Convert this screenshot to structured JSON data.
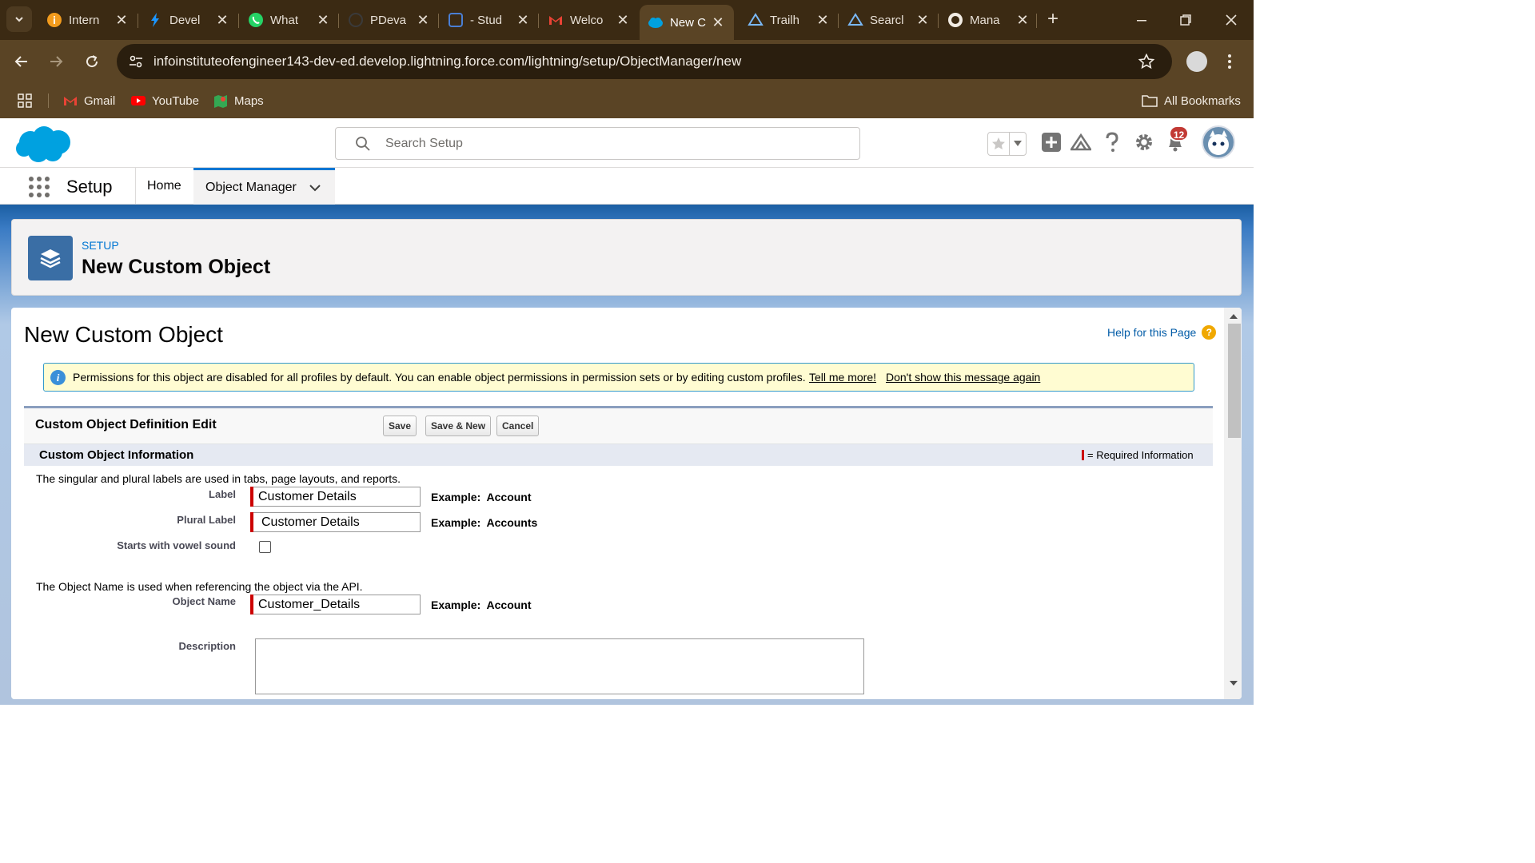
{
  "browser": {
    "tabs": [
      {
        "title": "Intern",
        "icon": "info-circle-icon"
      },
      {
        "title": "Devel",
        "icon": "lightning-icon"
      },
      {
        "title": "What",
        "icon": "whatsapp-icon"
      },
      {
        "title": "PDeva",
        "icon": "github-icon"
      },
      {
        "title": "- Stud",
        "icon": "screen-icon"
      },
      {
        "title": "Welco",
        "icon": "gmail-icon"
      },
      {
        "title": "New C",
        "icon": "salesforce-cloud-icon"
      },
      {
        "title": "Trailh",
        "icon": "trailhead-icon"
      },
      {
        "title": "Searcl",
        "icon": "trailhead-icon"
      },
      {
        "title": "Mana",
        "icon": "github-icon"
      }
    ],
    "active_tab_index": 6,
    "url": "infoinstituteofengineer143-dev-ed.develop.lightning.force.com/lightning/setup/ObjectManager/new",
    "bookmarks": [
      {
        "label": "Gmail",
        "icon": "gmail-icon"
      },
      {
        "label": "YouTube",
        "icon": "youtube-icon"
      },
      {
        "label": "Maps",
        "icon": "maps-icon"
      }
    ],
    "all_bookmarks_label": "All Bookmarks"
  },
  "sf": {
    "search_placeholder": "Search Setup",
    "notification_count": "12",
    "app_name": "Setup",
    "nav": {
      "home_label": "Home",
      "object_manager_label": "Object Manager"
    },
    "page_header": {
      "eyebrow": "SETUP",
      "title": "New Custom Object"
    }
  },
  "form": {
    "title": "New Custom Object",
    "help_link": "Help for this Page",
    "info": {
      "text": "Permissions for this object are disabled for all profiles by default. You can enable object permissions in permission sets or by editing custom profiles.",
      "link_tell_more": "Tell me more!",
      "link_dont_show": "Don't show this message again"
    },
    "block_title": "Custom Object Definition Edit",
    "buttons": {
      "save": "Save",
      "save_new": "Save & New",
      "cancel": "Cancel"
    },
    "section_title": "Custom Object Information",
    "required_legend": "= Required Information",
    "labels_help": "The singular and plural labels are used in tabs, page layouts, and reports.",
    "label_field": {
      "label": "Label",
      "value": "Customer Details",
      "example_prefix": "Example:",
      "example_value": "Account"
    },
    "plural_field": {
      "label": "Plural Label",
      "value": "Customer Details",
      "example_prefix": "Example:",
      "example_value": "Accounts"
    },
    "vowel_field": {
      "label": "Starts with vowel sound",
      "checked": false
    },
    "api_help": "The Object Name is used when referencing the object via the API.",
    "object_name_field": {
      "label": "Object Name",
      "value": "Customer_Details",
      "example_prefix": "Example:",
      "example_value": "Account"
    },
    "description_field": {
      "label": "Description",
      "value": ""
    }
  }
}
